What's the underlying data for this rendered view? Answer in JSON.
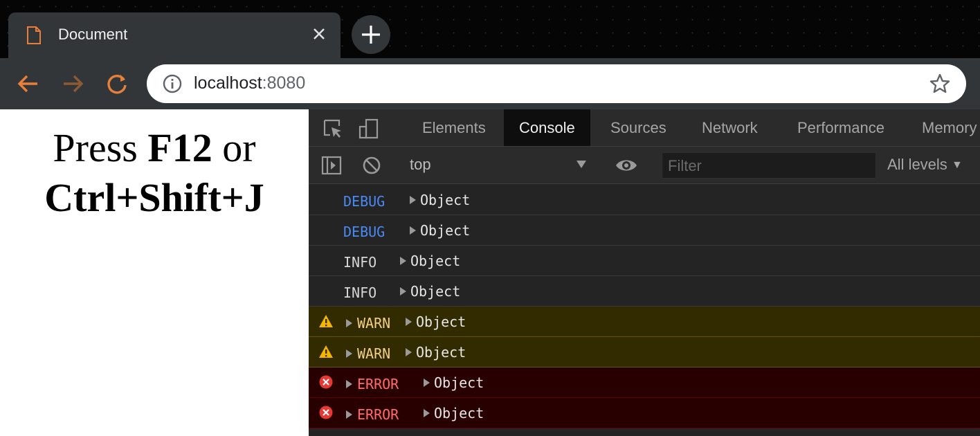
{
  "browser": {
    "tab_title": "Document",
    "address_host": "localhost",
    "address_port": ":8080"
  },
  "page": {
    "line1_prefix": "Press ",
    "line1_key": "F12",
    "line1_suffix": " or",
    "line2": "Ctrl+Shift+J"
  },
  "devtools": {
    "tabs": [
      "Elements",
      "Console",
      "Sources",
      "Network",
      "Performance",
      "Memory"
    ],
    "active_tab": "Console",
    "context": "top",
    "filter_placeholder": "Filter",
    "levels": "All levels",
    "messages": [
      {
        "level": "DEBUG",
        "text": "Object"
      },
      {
        "level": "DEBUG",
        "text": "Object"
      },
      {
        "level": "INFO",
        "text": "Object"
      },
      {
        "level": "INFO",
        "text": "Object"
      },
      {
        "level": "WARN",
        "text": "Object"
      },
      {
        "level": "WARN",
        "text": "Object"
      },
      {
        "level": "ERROR",
        "text": "Object"
      },
      {
        "level": "ERROR",
        "text": "Object"
      }
    ]
  },
  "colors": {
    "debug": "#4a8af4",
    "info": "#d6d6d6",
    "warn": "#f2d084",
    "error": "#ff6b6b",
    "accent_nav": "#e8803a"
  },
  "icons": {
    "tab_page": "document-icon",
    "close": "close-icon",
    "new_tab": "plus-icon",
    "back": "back-arrow-icon",
    "forward": "forward-arrow-icon",
    "reload": "reload-icon",
    "info": "info-icon",
    "bookmark": "star-icon",
    "inspect": "inspect-element-icon",
    "device": "device-toggle-icon",
    "sidebar": "sidebar-toggle-icon",
    "clear": "clear-console-icon",
    "live_expression": "eye-icon",
    "warning": "warning-icon",
    "error": "error-icon"
  }
}
